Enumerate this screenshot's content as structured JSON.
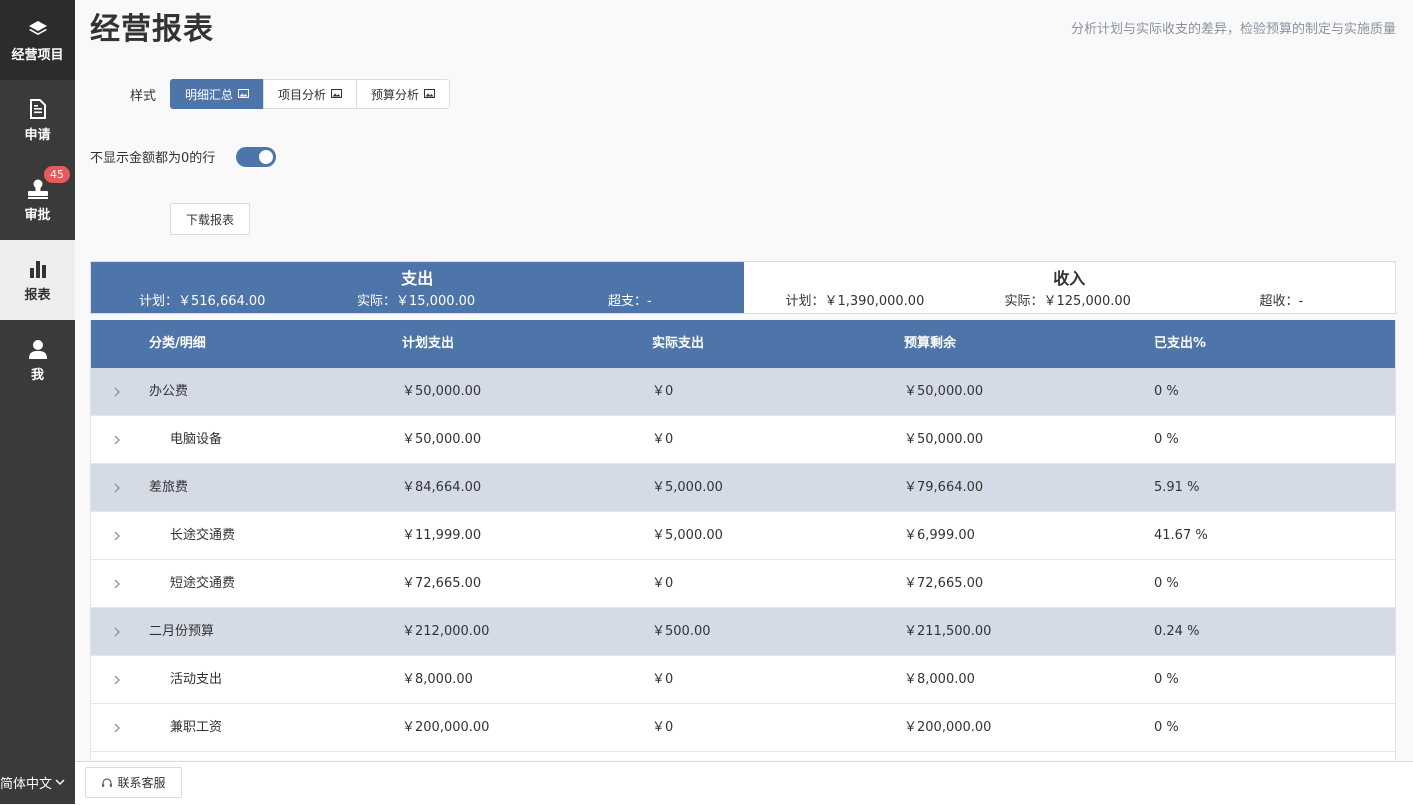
{
  "sidebar": {
    "items": [
      {
        "label": "经营项目",
        "icon": "layers-icon"
      },
      {
        "label": "申请",
        "icon": "document-icon"
      },
      {
        "label": "审批",
        "icon": "stamp-icon",
        "badge": "45"
      },
      {
        "label": "报表",
        "icon": "bar-chart-icon"
      },
      {
        "label": "我",
        "icon": "user-icon"
      }
    ],
    "language": "简体中文"
  },
  "header": {
    "title": "经营报表",
    "subtitle": "分析计划与实际收支的差异，检验预算的制定与实施质量"
  },
  "controls": {
    "style_label": "样式",
    "tabs": [
      "明细汇总",
      "项目分析",
      "预算分析"
    ],
    "active_tab": "明细汇总",
    "toggle_label": "不显示金额都为0的行",
    "toggle_on": true,
    "download_label": "下载报表"
  },
  "summary": {
    "expense": {
      "title": "支出",
      "plan": "计划：￥516,664.00",
      "actual": "实际：￥15,000.00",
      "over": "超支：-"
    },
    "income": {
      "title": "收入",
      "plan": "计划：￥1,390,000.00",
      "actual": "实际：￥125,000.00",
      "over": "超收：-"
    }
  },
  "table": {
    "headers": [
      "分类/明细",
      "计划支出",
      "实际支出",
      "预算剩余",
      "已支出%"
    ],
    "rows": [
      {
        "type": "parent",
        "cells": [
          "办公费",
          "￥50,000.00",
          "￥0",
          "￥50,000.00",
          "0 %"
        ]
      },
      {
        "type": "child",
        "cells": [
          "电脑设备",
          "￥50,000.00",
          "￥0",
          "￥50,000.00",
          "0 %"
        ]
      },
      {
        "type": "parent",
        "cells": [
          "差旅费",
          "￥84,664.00",
          "￥5,000.00",
          "￥79,664.00",
          "5.91 %"
        ]
      },
      {
        "type": "child",
        "cells": [
          "长途交通费",
          "￥11,999.00",
          "￥5,000.00",
          "￥6,999.00",
          "41.67 %"
        ]
      },
      {
        "type": "child",
        "cells": [
          "短途交通费",
          "￥72,665.00",
          "￥0",
          "￥72,665.00",
          "0 %"
        ]
      },
      {
        "type": "parent",
        "cells": [
          "二月份预算",
          "￥212,000.00",
          "￥500.00",
          "￥211,500.00",
          "0.24 %"
        ]
      },
      {
        "type": "child",
        "cells": [
          "活动支出",
          "￥8,000.00",
          "￥0",
          "￥8,000.00",
          "0 %"
        ]
      },
      {
        "type": "child",
        "cells": [
          "兼职工资",
          "￥200,000.00",
          "￥0",
          "￥200,000.00",
          "0 %"
        ]
      }
    ]
  },
  "footer": {
    "support_label": "联系客服"
  },
  "colors": {
    "primary": "#4e75aa",
    "sidebar_bg": "#3a3a3a",
    "parent_row": "#d5dbe6",
    "badge": "#e9585a"
  }
}
